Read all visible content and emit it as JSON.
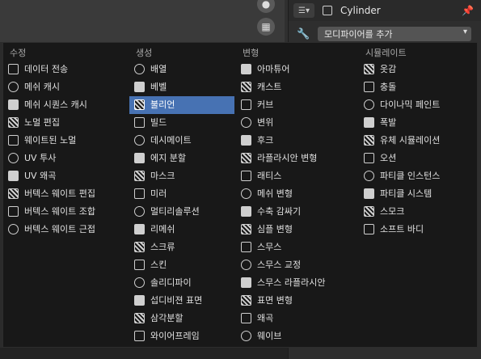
{
  "props_panel": {
    "object_name": "Cylinder",
    "add_modifier_label": "모디파이어를 추가"
  },
  "menu": {
    "columns": [
      {
        "title": "수정",
        "items": [
          {
            "label": "데이터 전송",
            "icon": "data-transfer-icon"
          },
          {
            "label": "메쉬 캐시",
            "icon": "mesh-cache-icon"
          },
          {
            "label": "메쉬 시퀀스 캐시",
            "icon": "mesh-sequence-cache-icon"
          },
          {
            "label": "노멀 편집",
            "icon": "normal-edit-icon"
          },
          {
            "label": "웨이트된 노멀",
            "icon": "weighted-normal-icon"
          },
          {
            "label": "UV 투사",
            "icon": "uv-project-icon"
          },
          {
            "label": "UV 왜곡",
            "icon": "uv-warp-icon"
          },
          {
            "label": "버텍스 웨이트 편집",
            "icon": "vertex-weight-edit-icon"
          },
          {
            "label": "버텍스 웨이트 조합",
            "icon": "vertex-weight-mix-icon"
          },
          {
            "label": "버텍스 웨이트 근접",
            "icon": "vertex-weight-proximity-icon"
          }
        ]
      },
      {
        "title": "생성",
        "items": [
          {
            "label": "배열",
            "icon": "array-icon"
          },
          {
            "label": "베벨",
            "icon": "bevel-icon"
          },
          {
            "label": "불리언",
            "icon": "boolean-icon",
            "active": true
          },
          {
            "label": "빌드",
            "icon": "build-icon"
          },
          {
            "label": "데시메이트",
            "icon": "decimate-icon"
          },
          {
            "label": "에지 분할",
            "icon": "edge-split-icon"
          },
          {
            "label": "마스크",
            "icon": "mask-icon"
          },
          {
            "label": "미러",
            "icon": "mirror-icon"
          },
          {
            "label": "멀티리솔루션",
            "icon": "multiresolution-icon"
          },
          {
            "label": "리메쉬",
            "icon": "remesh-icon"
          },
          {
            "label": "스크류",
            "icon": "screw-icon"
          },
          {
            "label": "스킨",
            "icon": "skin-icon"
          },
          {
            "label": "솔리디파이",
            "icon": "solidify-icon"
          },
          {
            "label": "섭디비젼 표면",
            "icon": "subdivision-surface-icon"
          },
          {
            "label": "삼각분할",
            "icon": "triangulate-icon"
          },
          {
            "label": "와이어프레임",
            "icon": "wireframe-icon"
          }
        ]
      },
      {
        "title": "변형",
        "items": [
          {
            "label": "아마튜어",
            "icon": "armature-icon"
          },
          {
            "label": "캐스트",
            "icon": "cast-icon"
          },
          {
            "label": "커브",
            "icon": "curve-icon"
          },
          {
            "label": "변위",
            "icon": "displace-icon"
          },
          {
            "label": "후크",
            "icon": "hook-icon"
          },
          {
            "label": "라플라시안 변형",
            "icon": "laplacian-deform-icon"
          },
          {
            "label": "래티스",
            "icon": "lattice-icon"
          },
          {
            "label": "메쉬 변형",
            "icon": "mesh-deform-icon"
          },
          {
            "label": "수축 감싸기",
            "icon": "shrinkwrap-icon"
          },
          {
            "label": "심플 변형",
            "icon": "simple-deform-icon"
          },
          {
            "label": "스무스",
            "icon": "smooth-icon"
          },
          {
            "label": "스무스 교정",
            "icon": "smooth-corrective-icon"
          },
          {
            "label": "스무스 라플라시안",
            "icon": "smooth-laplacian-icon"
          },
          {
            "label": "표면 변형",
            "icon": "surface-deform-icon"
          },
          {
            "label": "왜곡",
            "icon": "warp-icon"
          },
          {
            "label": "웨이브",
            "icon": "wave-icon"
          }
        ]
      },
      {
        "title": "시뮬레이트",
        "items": [
          {
            "label": "옷감",
            "icon": "cloth-icon"
          },
          {
            "label": "충돌",
            "icon": "collision-icon"
          },
          {
            "label": "다이나믹 페인트",
            "icon": "dynamic-paint-icon"
          },
          {
            "label": "폭발",
            "icon": "explode-icon"
          },
          {
            "label": "유체 시뮬레이션",
            "icon": "fluid-simulation-icon"
          },
          {
            "label": "오션",
            "icon": "ocean-icon"
          },
          {
            "label": "파티클 인스턴스",
            "icon": "particle-instance-icon"
          },
          {
            "label": "파티클 시스템",
            "icon": "particle-system-icon"
          },
          {
            "label": "스모크",
            "icon": "smoke-icon"
          },
          {
            "label": "소프트 바디",
            "icon": "soft-body-icon"
          }
        ]
      }
    ]
  }
}
